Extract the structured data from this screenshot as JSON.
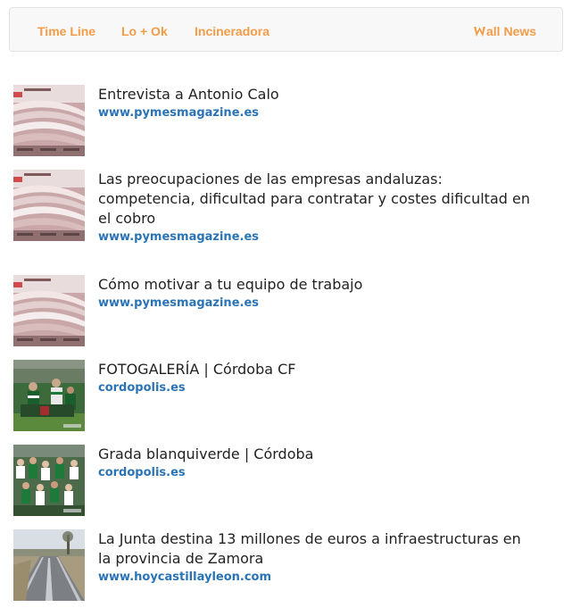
{
  "navbar": {
    "links": [
      "Time Line",
      "Lo + Ok",
      "Incineradora"
    ],
    "brand": "all News",
    "brand_logo_icon": "w-logo-icon"
  },
  "colors": {
    "nav_link": "#f39c48",
    "source_link": "#2a73b5",
    "title_text": "#222222"
  },
  "feed": [
    {
      "title": "Entrevista a Antonio Calo",
      "source": "www.pymesmagazine.es",
      "thumb_icon": "newspaper-stack-image"
    },
    {
      "title": "Las preocupaciones de las empresas andaluzas: competencia, dificultad para contratar y costes dificultad en el cobro",
      "source": "www.pymesmagazine.es",
      "thumb_icon": "newspaper-stack-image"
    },
    {
      "title": "Cómo motivar a tu equipo de trabajo",
      "source": "www.pymesmagazine.es",
      "thumb_icon": "newspaper-stack-image"
    },
    {
      "title": "FOTOGALERÍA | Córdoba CF",
      "source": "cordopolis.es",
      "thumb_icon": "football-players-photo"
    },
    {
      "title": "Grada blanquiverde | Córdoba",
      "source": "cordopolis.es",
      "thumb_icon": "stadium-crowd-photo"
    },
    {
      "title": "La Junta destina 13 millones de euros a infraestructuras en la provincia de Zamora",
      "source": "www.hoycastillayleon.com",
      "thumb_icon": "rural-road-photo"
    }
  ]
}
